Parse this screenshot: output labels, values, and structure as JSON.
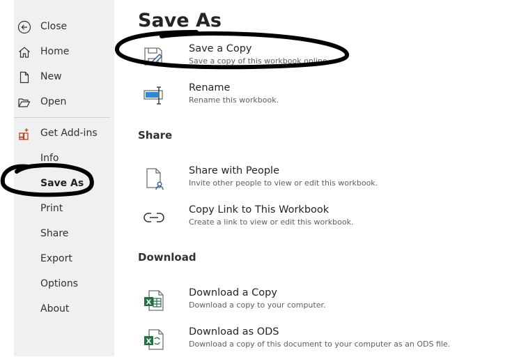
{
  "nav": {
    "close": "Close",
    "home": "Home",
    "new": "New",
    "open": "Open",
    "get_addins": "Get Add-ins",
    "info": "Info",
    "save_as": "Save As",
    "print": "Print",
    "share": "Share",
    "export": "Export",
    "options": "Options",
    "about": "About"
  },
  "page": {
    "title": "Save As"
  },
  "save_options": [
    {
      "title": "Save a Copy",
      "subtitle": "Save a copy of this workbook online."
    },
    {
      "title": "Rename",
      "subtitle": "Rename this workbook."
    }
  ],
  "share_section": {
    "heading": "Share",
    "items": [
      {
        "title": "Share with People",
        "subtitle": "Invite other people to view or edit this workbook."
      },
      {
        "title": "Copy Link to This Workbook",
        "subtitle": "Create a link to view or edit this workbook."
      }
    ]
  },
  "download_section": {
    "heading": "Download",
    "items": [
      {
        "title": "Download a Copy",
        "subtitle": "Download a copy to your computer."
      },
      {
        "title": "Download as ODS",
        "subtitle": "Download a copy of this document to your computer as an ODS file."
      }
    ]
  },
  "colors": {
    "excel_green": "#217346",
    "addins_red": "#c43e1c",
    "accent_blue": "#2b579a"
  }
}
